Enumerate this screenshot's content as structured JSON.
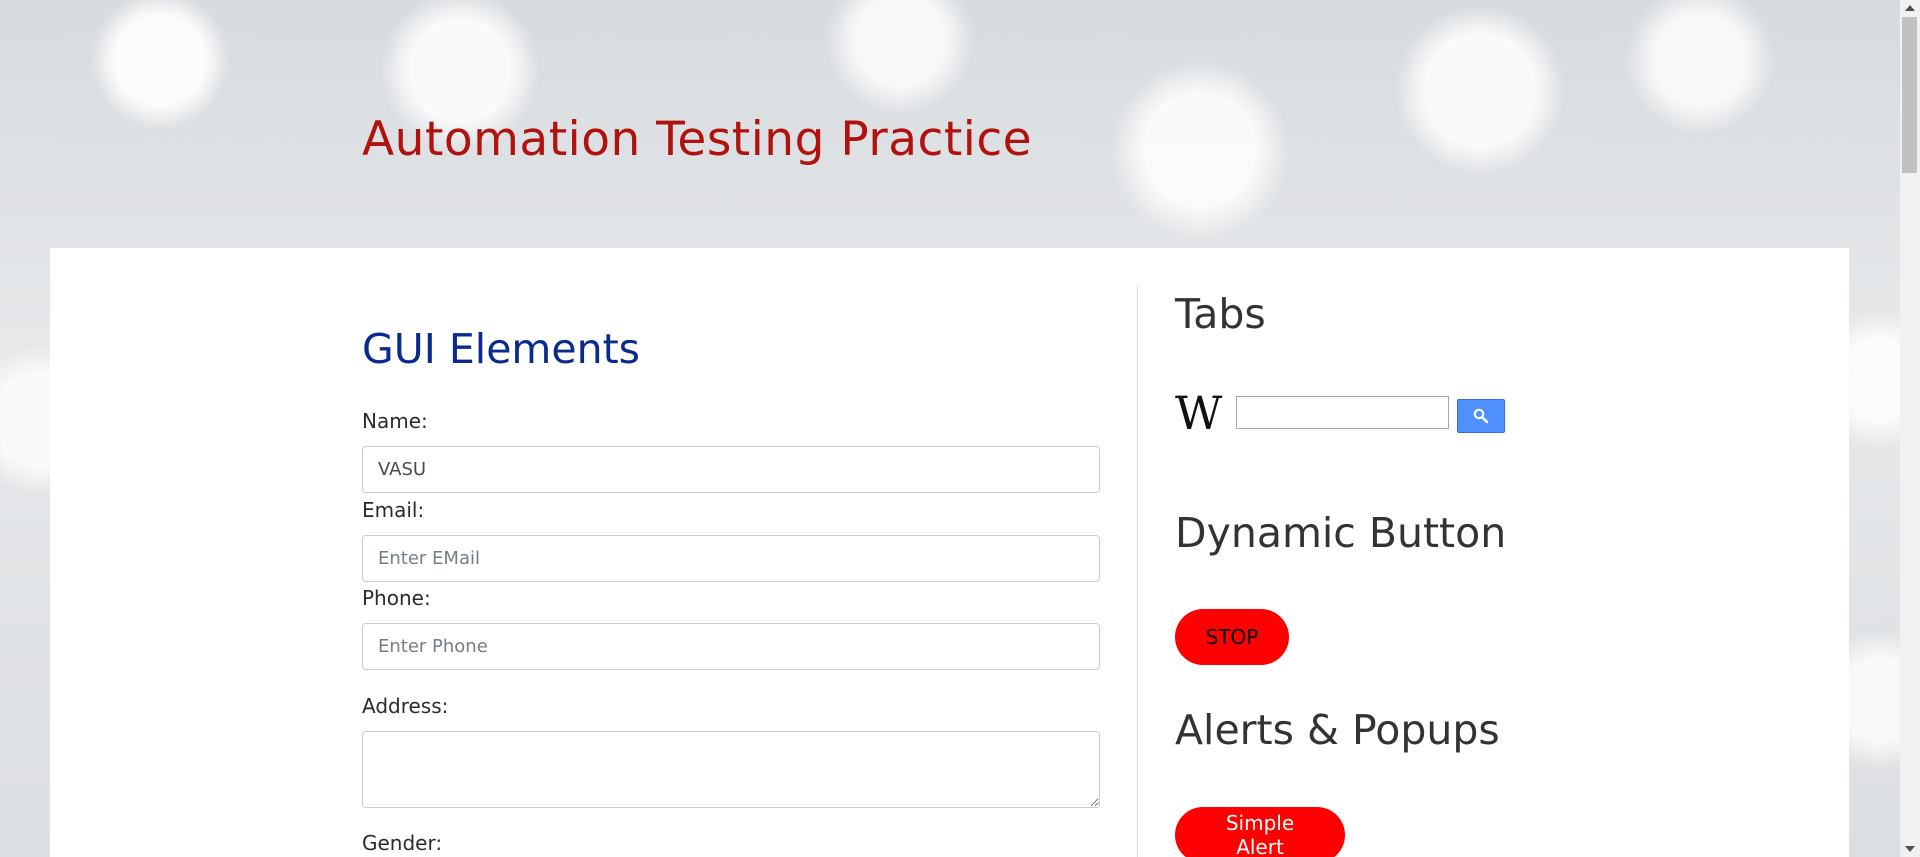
{
  "header": {
    "title": "Automation Testing Practice"
  },
  "left": {
    "section_title": "GUI Elements",
    "name": {
      "label": "Name:",
      "value": "VASU"
    },
    "email": {
      "label": "Email:",
      "placeholder": "Enter EMail"
    },
    "phone": {
      "label": "Phone:",
      "placeholder": "Enter Phone"
    },
    "address": {
      "label": "Address:"
    },
    "gender": {
      "label": "Gender:"
    }
  },
  "right": {
    "tabs_title": "Tabs",
    "wikipedia": {
      "logo": "W"
    },
    "dynamic_title": "Dynamic Button",
    "dynamic_button": "STOP",
    "alerts_title": "Alerts & Popups",
    "simple_alert_button": "Simple Alert"
  },
  "icons": {
    "search": "search-icon",
    "wiki": "wikipedia-logo-icon"
  },
  "colors": {
    "site_title": "#b1120e",
    "section_title": "#0a2a8f",
    "button_red": "#ff0000",
    "search_button": "#4d90fe"
  }
}
